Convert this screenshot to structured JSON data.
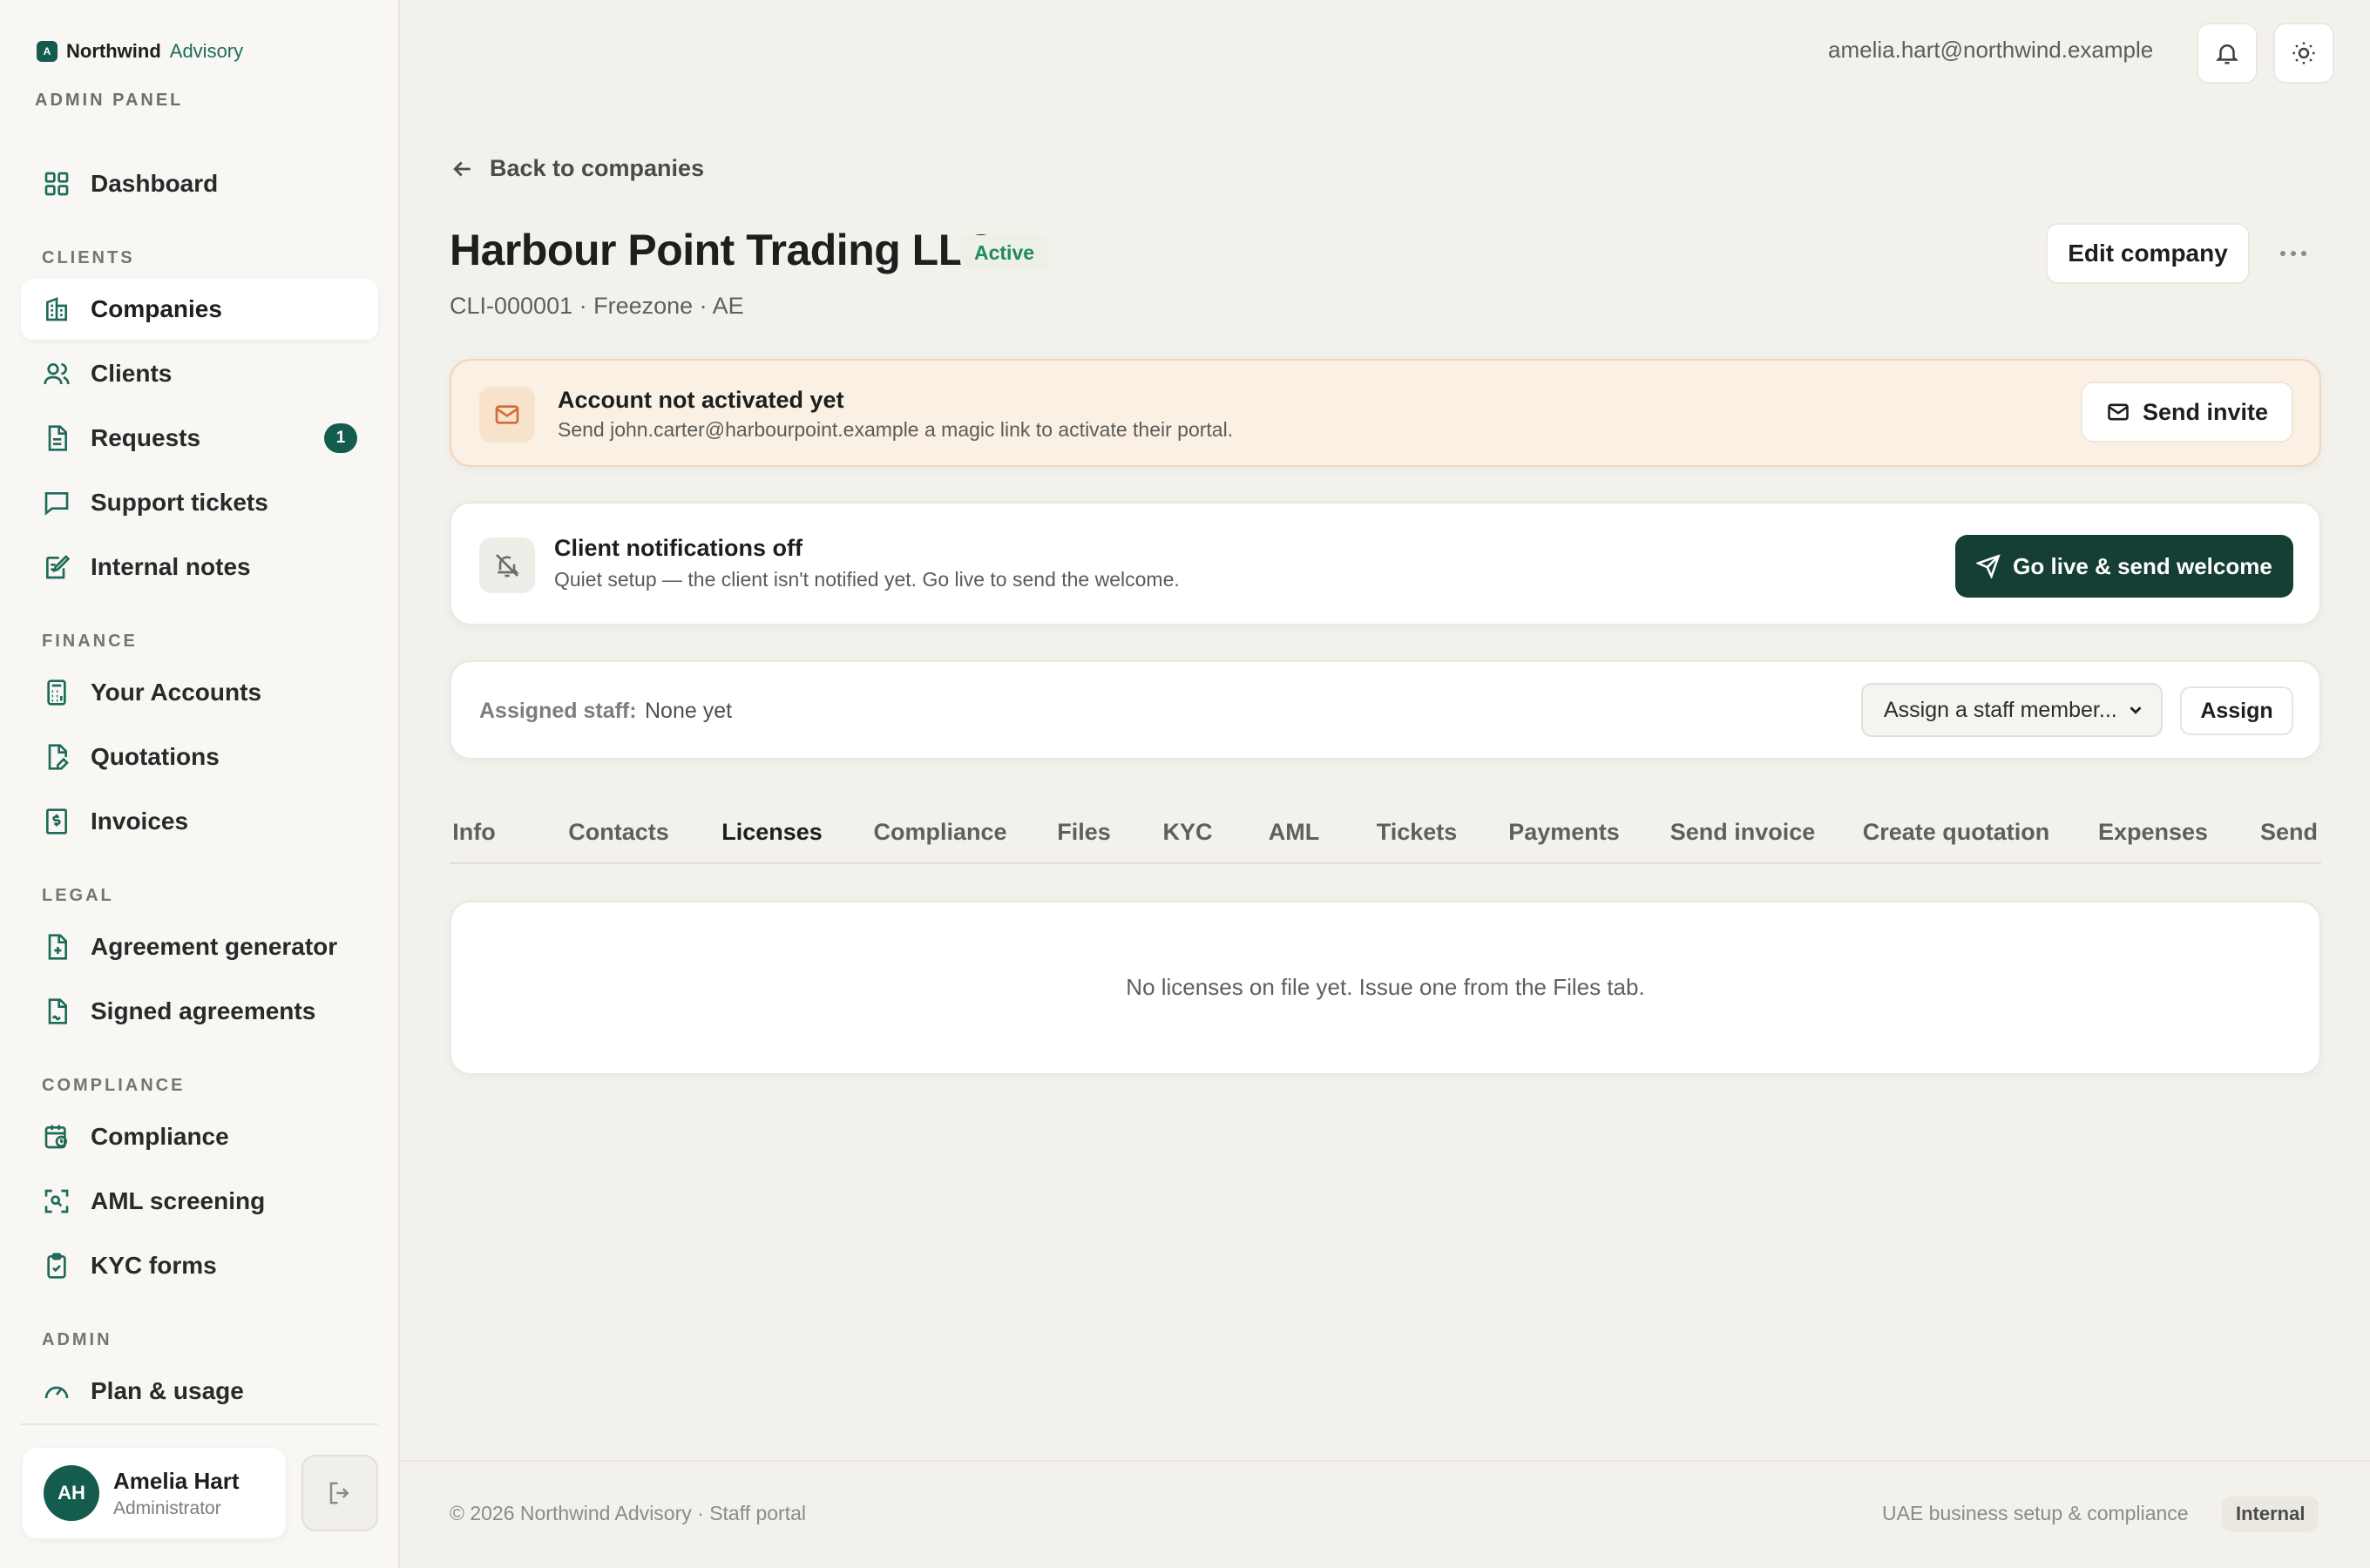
{
  "brand": {
    "name": "Northwind",
    "sub": "Advisory",
    "logo_letter": "A"
  },
  "panel_label": "ADMIN PANEL",
  "sidebar": {
    "dashboard": "Dashboard",
    "sections": {
      "clients": "CLIENTS",
      "finance": "FINANCE",
      "legal": "LEGAL",
      "compliance": "COMPLIANCE",
      "admin": "ADMIN"
    },
    "items": {
      "companies": "Companies",
      "clients": "Clients",
      "requests": "Requests",
      "requests_badge": "1",
      "support_tickets": "Support tickets",
      "internal_notes": "Internal notes",
      "your_accounts": "Your Accounts",
      "quotations": "Quotations",
      "invoices": "Invoices",
      "agreement_generator": "Agreement generator",
      "signed_agreements": "Signed agreements",
      "compliance": "Compliance",
      "aml_screening": "AML screening",
      "kyc_forms": "KYC forms",
      "plan_usage": "Plan & usage"
    }
  },
  "user": {
    "initials": "AH",
    "name": "Amelia Hart",
    "role": "Administrator"
  },
  "topbar": {
    "email": "amelia.hart@northwind.example"
  },
  "page": {
    "back": "Back to companies",
    "title": "Harbour Point Trading LLC",
    "status": "Active",
    "subtitle": "CLI-000001 · Freezone · AE",
    "edit_button": "Edit company"
  },
  "activation": {
    "title": "Account not activated yet",
    "desc": "Send john.carter@harbourpoint.example a magic link to activate their portal.",
    "button": "Send invite"
  },
  "notifications": {
    "title": "Client notifications off",
    "desc": "Quiet setup — the client isn't notified yet. Go live to send the welcome.",
    "button": "Go live & send welcome"
  },
  "staff": {
    "label": "Assigned staff:",
    "value": "None yet",
    "select_value": "Assign a staff member...",
    "button": "Assign"
  },
  "tabs": [
    "Info",
    "Contacts",
    "Licenses",
    "Compliance",
    "Files",
    "KYC",
    "AML",
    "Tickets",
    "Payments",
    "Send invoice",
    "Create quotation",
    "Expenses",
    "Send"
  ],
  "active_tab": "Licenses",
  "empty_message": "No licenses on file yet. Issue one from the Files tab.",
  "footer": {
    "left": "© 2026 Northwind Advisory · Staff portal",
    "right": "UAE business setup & compliance",
    "badge": "Internal"
  },
  "colors": {
    "accent": "#145c4d",
    "primary_button": "#153f34",
    "status_green": "#1f8a5a",
    "warn_bg": "#fbf0e4"
  }
}
